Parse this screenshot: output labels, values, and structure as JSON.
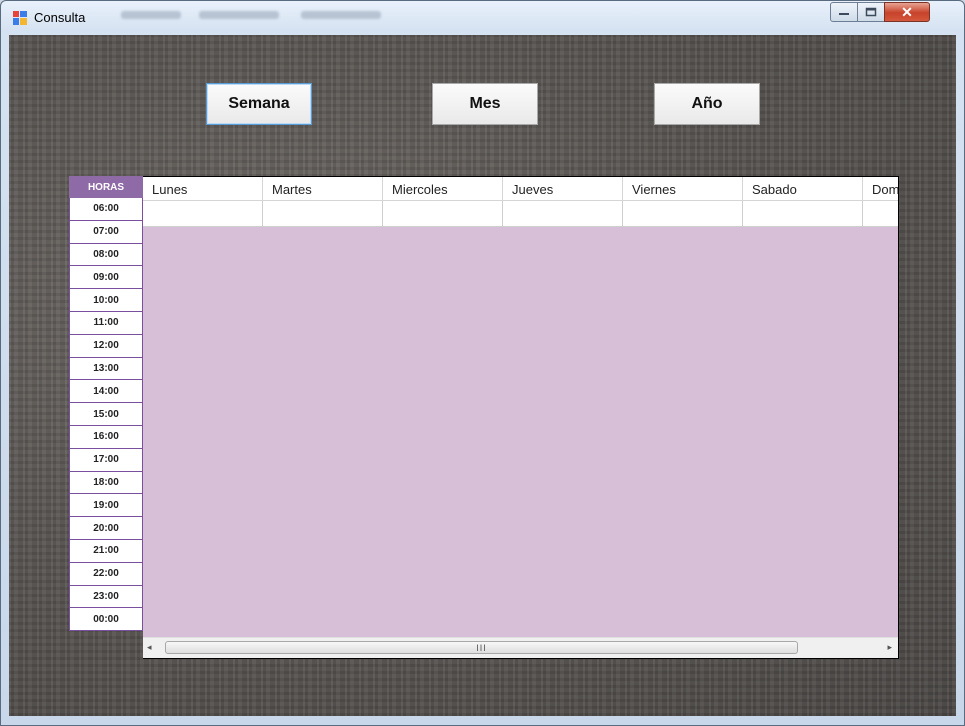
{
  "window": {
    "title": "Consulta",
    "controls": {
      "close_glyph": "✕"
    }
  },
  "toolbar": {
    "buttons": [
      {
        "label": "Semana"
      },
      {
        "label": "Mes"
      },
      {
        "label": "Año"
      }
    ]
  },
  "schedule": {
    "hours_header": "HORAS",
    "hours": [
      "06:00",
      "07:00",
      "08:00",
      "09:00",
      "10:00",
      "11:00",
      "12:00",
      "13:00",
      "14:00",
      "15:00",
      "16:00",
      "17:00",
      "18:00",
      "19:00",
      "20:00",
      "21:00",
      "22:00",
      "23:00",
      "00:00"
    ],
    "columns": [
      "Lunes",
      "Martes",
      "Miercoles",
      "Jueves",
      "Viernes",
      "Sabado",
      "Domingo"
    ],
    "row": [
      "",
      "",
      "",
      "",
      "",
      "",
      ""
    ]
  },
  "scrollbar": {
    "left_arrow": "◂",
    "right_arrow": "▸",
    "grip": "III"
  },
  "colors": {
    "grid_background": "#d8bfd8",
    "hours_header": "#8e6aa6",
    "hours_border": "#7b4fa0",
    "close_button": "#c7422a"
  }
}
